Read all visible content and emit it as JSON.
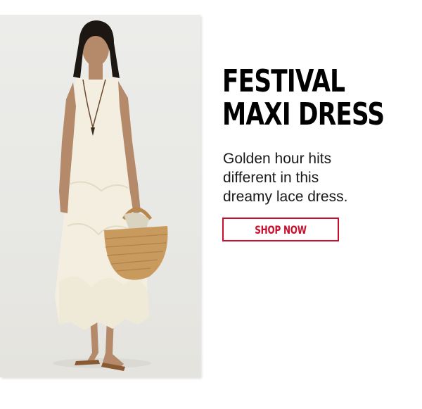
{
  "product": {
    "title_lines": [
      "FESTIVAL",
      "MAXI DRESS"
    ],
    "description_lines": [
      "Golden hour hits",
      "different in this",
      "dreamy lace dress."
    ],
    "cta_label": "SHOP NOW",
    "image_icon": "model-photo-icon"
  },
  "colors": {
    "accent": "#c8102e",
    "headline": "#000000",
    "body_text": "#1a1a1a",
    "photo_background": "#e9e9e6"
  }
}
